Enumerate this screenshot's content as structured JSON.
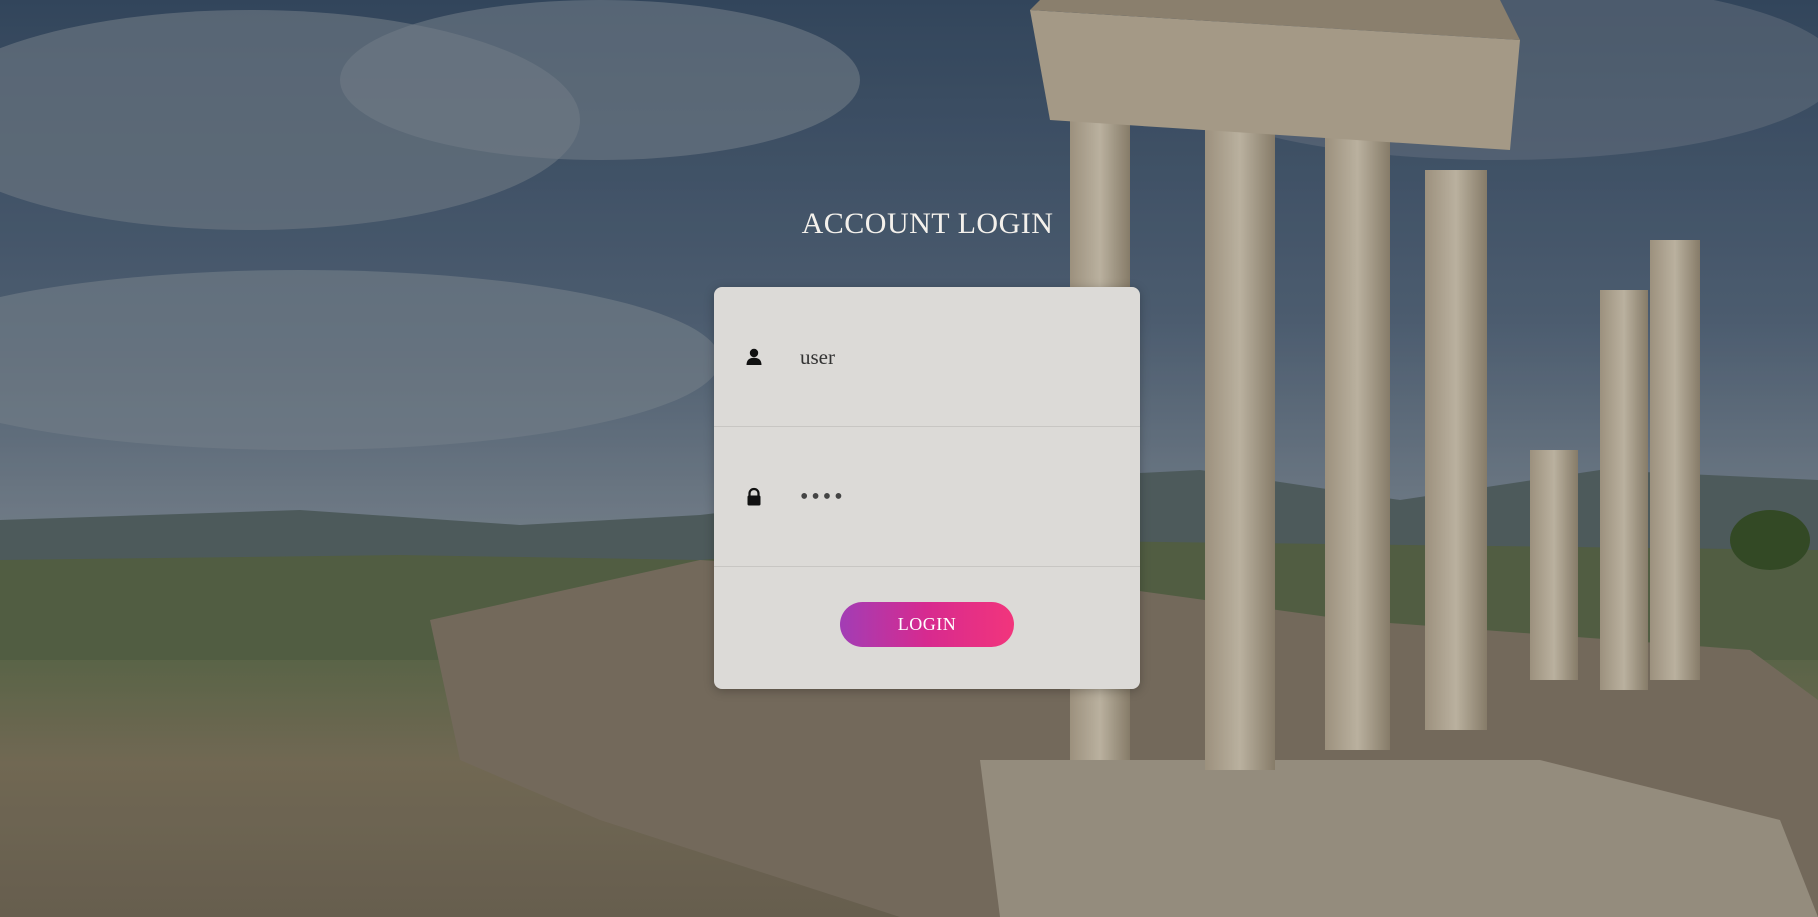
{
  "page": {
    "title": "ACCOUNT LOGIN"
  },
  "form": {
    "username_value": "user",
    "password_value": "pass",
    "login_label": "LOGIN"
  },
  "icons": {
    "username": "user-icon",
    "password": "lock-icon"
  },
  "colors": {
    "card_background": "#dcdad7",
    "button_gradient_start": "#a23db5",
    "button_gradient_end": "#f2357c",
    "title_text": "#f4f1ec"
  }
}
